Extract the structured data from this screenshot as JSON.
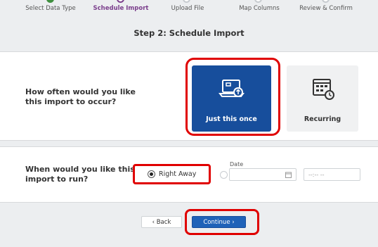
{
  "stepper": {
    "steps": [
      {
        "label": "Select Data Type",
        "state": "done"
      },
      {
        "label": "Schedule Import",
        "state": "current"
      },
      {
        "label": "Upload File",
        "state": "pending"
      },
      {
        "label": "Map Columns",
        "state": "pending"
      },
      {
        "label": "Review & Confirm",
        "state": "pending"
      }
    ],
    "colors": {
      "done": "#3f8f3f",
      "current": "#7b3f8c",
      "pending": "#c8ccd0"
    }
  },
  "step_title": "Step 2: Schedule Import",
  "frequency": {
    "question": "How often would you like this import to occur?",
    "options": [
      {
        "label": "Just this once",
        "icon": "laptop-upload-icon",
        "selected": true
      },
      {
        "label": "Recurring",
        "icon": "calendar-recurring-icon",
        "selected": false
      }
    ]
  },
  "timing": {
    "question": "When would you like this import to run?",
    "right_away_label": "Right Away",
    "date_label": "Date",
    "date_value": "",
    "time_placeholder": "--:-- --"
  },
  "buttons": {
    "back_label": "‹ Back",
    "continue_label": "Continue ›"
  },
  "colors": {
    "primary": "#174e9c",
    "highlight": "#e00000"
  }
}
